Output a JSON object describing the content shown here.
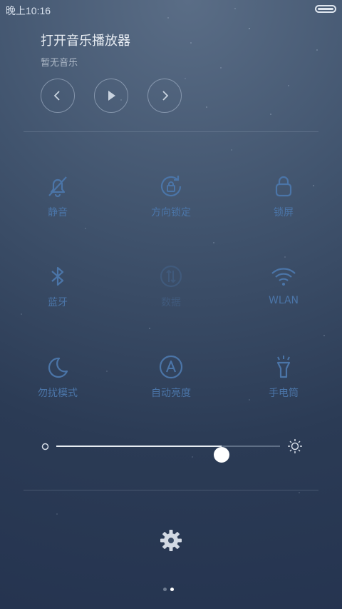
{
  "status_bar": {
    "time": "晚上10:16"
  },
  "music": {
    "title": "打开音乐播放器",
    "subtitle": "暂无音乐"
  },
  "toggles": [
    {
      "label": "静音",
      "icon": "bell-off-icon"
    },
    {
      "label": "方向锁定",
      "icon": "rotation-lock-icon"
    },
    {
      "label": "锁屏",
      "icon": "lock-icon"
    },
    {
      "label": "蓝牙",
      "icon": "bluetooth-icon"
    },
    {
      "label": "数据",
      "icon": "data-icon"
    },
    {
      "label": "WLAN",
      "icon": "wifi-icon"
    },
    {
      "label": "勿扰模式",
      "icon": "moon-icon"
    },
    {
      "label": "自动亮度",
      "icon": "auto-brightness-icon"
    },
    {
      "label": "手电筒",
      "icon": "flashlight-icon"
    }
  ],
  "brightness": {
    "level": 0.74
  },
  "pager": {
    "pages": 2,
    "current": 2
  },
  "colors": {
    "active": "#4b75a8",
    "inactive": "#405a7c"
  }
}
